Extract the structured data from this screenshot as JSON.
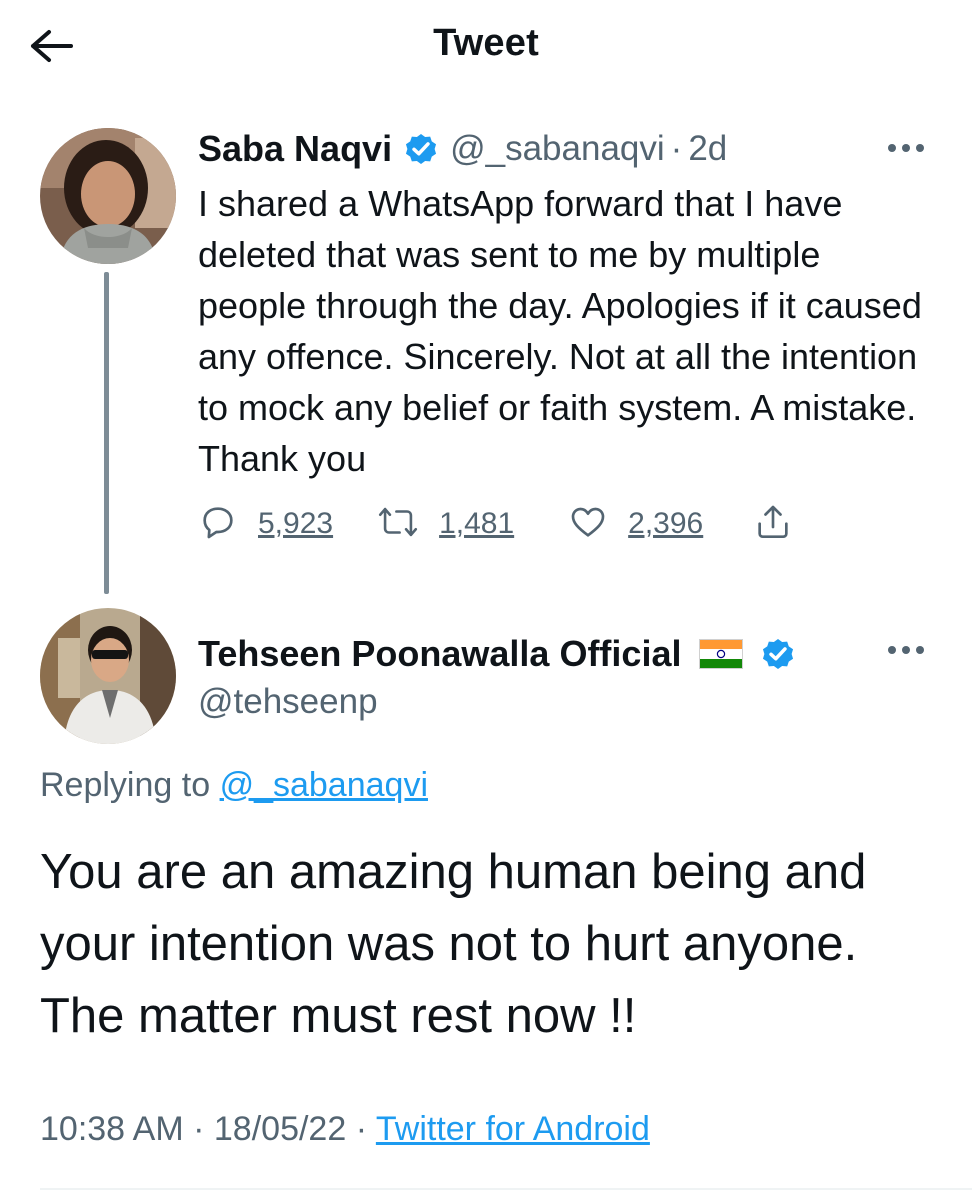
{
  "header": {
    "title": "Tweet",
    "back_icon": "back-arrow-icon"
  },
  "tweet1": {
    "author_name": "Saba Naqvi",
    "handle": "@_sabanaqvi",
    "separator": "·",
    "age": "2d",
    "verified": true,
    "text": "I shared a WhatsApp forward that I have deleted that was sent to me by multiple people through the day. Apologies if it caused any offence. Sincerely. Not at all the intention to mock any belief or faith system. A mistake. Thank you",
    "replies": "5,923",
    "retweets": "1,481",
    "likes": "2,396"
  },
  "tweet2": {
    "author_name": "Tehseen Poonawalla Official",
    "handle": "@tehseenp",
    "verified": true,
    "flag": "india-flag",
    "replying_prefix": "Replying to",
    "replying_handle": "@_sabanaqvi",
    "text": "You are an amazing human being and your intention was not to hurt anyone. The matter must rest now !!",
    "time": "10:38 AM",
    "meta_separator": "·",
    "date": "18/05/22",
    "source": "Twitter for Android"
  },
  "colors": {
    "text_primary": "#0f1419",
    "text_secondary": "#536471",
    "link": "#1d9bf0",
    "verified_badge": "#1d9bf0"
  }
}
